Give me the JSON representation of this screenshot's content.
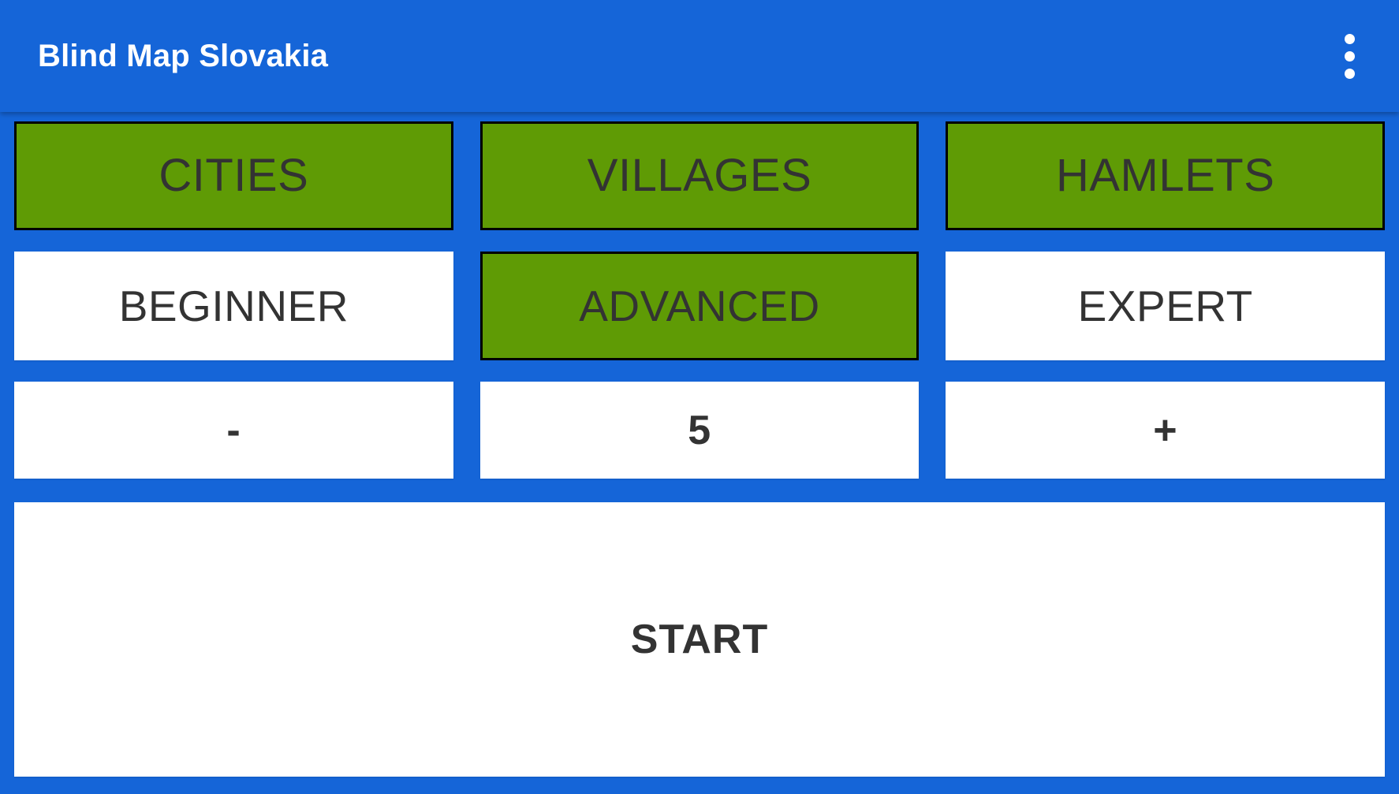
{
  "app": {
    "title": "Blind Map Slovakia",
    "accent_color": "#1565d8",
    "selected_color": "#5f9b05",
    "surface_color": "#ffffff",
    "text_color": "#333333",
    "border_color": "#000000"
  },
  "appbar": {
    "title": "Blind Map Slovakia",
    "overflow_icon": "more-vertical-icon"
  },
  "categories": {
    "selected": "HAMLETS",
    "items": [
      {
        "label": "CITIES",
        "selected": true
      },
      {
        "label": "VILLAGES",
        "selected": true
      },
      {
        "label": "HAMLETS",
        "selected": true
      }
    ]
  },
  "difficulty": {
    "selected": "ADVANCED",
    "items": [
      {
        "label": "BEGINNER",
        "selected": false
      },
      {
        "label": "ADVANCED",
        "selected": true
      },
      {
        "label": "EXPERT",
        "selected": false
      }
    ]
  },
  "counter": {
    "decrement_label": "-",
    "value": "5",
    "increment_label": "+"
  },
  "start": {
    "label": "START"
  }
}
